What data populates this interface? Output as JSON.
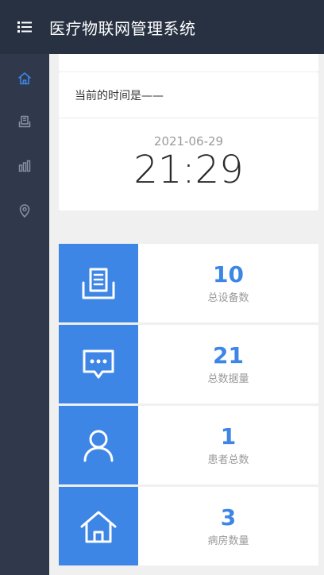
{
  "header": {
    "title": "医疗物联网管理系统",
    "menu_icon": "list-menu-icon"
  },
  "sidebar": {
    "items": [
      {
        "icon": "home-icon",
        "active": true
      },
      {
        "icon": "book-icon",
        "active": false
      },
      {
        "icon": "bar-chart-icon",
        "active": false
      },
      {
        "icon": "location-pin-icon",
        "active": false
      }
    ]
  },
  "time_card": {
    "heading": "当前的时间是——",
    "date": "2021-06-29",
    "time": "21:29"
  },
  "stats": [
    {
      "value": "10",
      "label": "总设备数",
      "icon": "device-book-icon"
    },
    {
      "value": "21",
      "label": "总数据量",
      "icon": "message-dots-icon"
    },
    {
      "value": "1",
      "label": "患者总数",
      "icon": "user-icon"
    },
    {
      "value": "3",
      "label": "病房数量",
      "icon": "house-icon"
    }
  ],
  "colors": {
    "header_bg": "#273141",
    "sidebar_bg": "#30394b",
    "accent": "#3d86e6",
    "page_bg": "#f0f0f0"
  }
}
